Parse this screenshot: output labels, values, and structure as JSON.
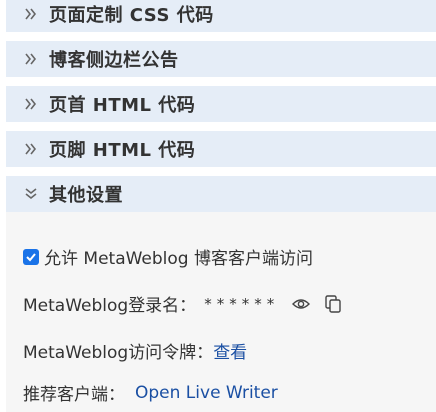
{
  "sections": [
    {
      "title": "页面定制 CSS 代码",
      "expanded": false
    },
    {
      "title": "博客侧边栏公告",
      "expanded": false
    },
    {
      "title": "页首 HTML 代码",
      "expanded": false
    },
    {
      "title": "页脚 HTML 代码",
      "expanded": false
    },
    {
      "title": "其他设置",
      "expanded": true
    }
  ],
  "other_settings": {
    "enable_label": "允许 MetaWeblog 博客客户端访问",
    "enable_checked": true,
    "login_label": "MetaWeblog登录名：",
    "login_masked": "******",
    "token_label": "MetaWeblog访问令牌：",
    "token_link": "查看",
    "client_label": "推荐客户端：",
    "client_link": "Open Live Writer"
  },
  "colors": {
    "header_bg": "#e5edf7",
    "panel_bg": "#f6f6f6",
    "checkbox": "#1a73e8",
    "link": "#1a4fa3"
  },
  "icons": [
    "chevron-right-double-icon",
    "chevron-down-double-icon",
    "eye-icon",
    "copy-icon",
    "checkmark-icon"
  ]
}
